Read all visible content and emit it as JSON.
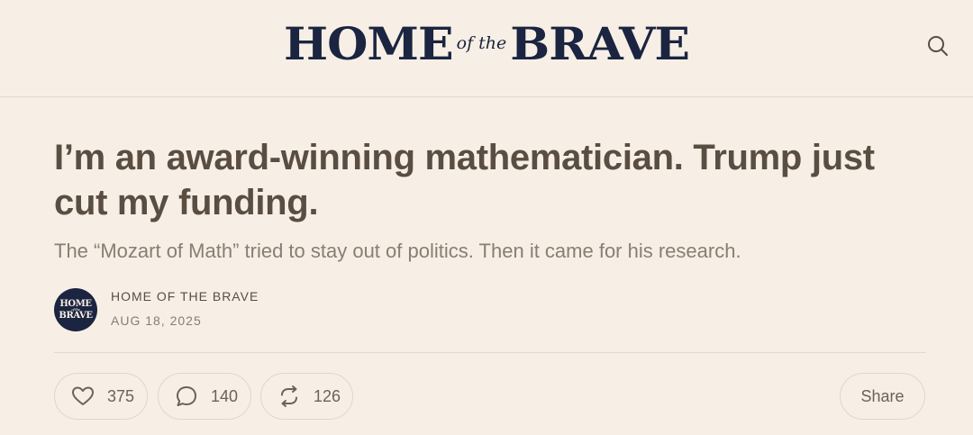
{
  "header": {
    "logo": {
      "word1": "HOME",
      "connector": "of the",
      "word2": "BRAVE"
    },
    "search_icon": "search-icon"
  },
  "article": {
    "title": "I’m an award-winning mathematician. Trump just cut my funding.",
    "subtitle": "The “Mozart of Math” tried to stay out of politics. Then it came for his research.",
    "author": {
      "avatar": {
        "word1": "HOME",
        "connector": "of the",
        "word2": "BRAVE"
      },
      "name": "HOME OF THE BRAVE",
      "date": "AUG 18, 2025"
    }
  },
  "actions": {
    "likes": "375",
    "comments": "140",
    "restacks": "126",
    "share_label": "Share",
    "icons": [
      "heart-icon",
      "comment-icon",
      "restack-icon"
    ]
  },
  "colors": {
    "background": "#f7efe5",
    "logo_navy": "#1b2440",
    "text": "#5a4d42",
    "muted": "#8a7d71"
  }
}
